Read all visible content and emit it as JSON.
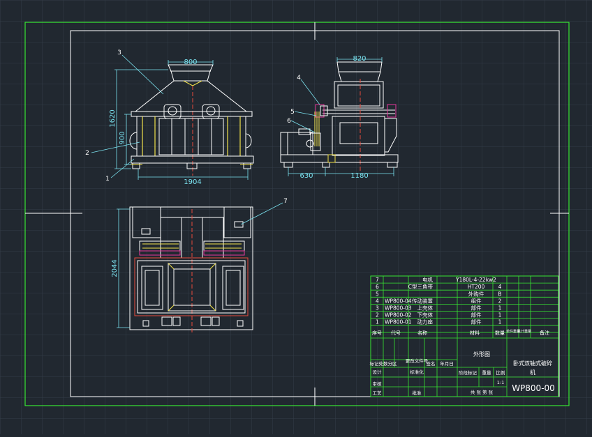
{
  "drawing": {
    "dimensions": {
      "top_width": "800",
      "height_total": "1620",
      "height_body": "900",
      "base_width": "1904",
      "side_width": "820",
      "motor_offset": "630",
      "side_base": "1180",
      "plan_depth": "2044"
    },
    "balloons": [
      "1",
      "2",
      "3",
      "4",
      "5",
      "6",
      "7"
    ]
  },
  "title_block": {
    "parts": [
      {
        "no": "7",
        "code": "",
        "name": "电机",
        "material": "Y180L-4-22kw2",
        "qty": "",
        "note": ""
      },
      {
        "no": "6",
        "code": "",
        "name": "C型三角带",
        "material": "HT200",
        "qty": "4",
        "note": ""
      },
      {
        "no": "5",
        "code": "",
        "name": "",
        "material": "外购件",
        "qty": "B",
        "note": ""
      },
      {
        "no": "4",
        "code": "WP800-04",
        "name": "传动装置",
        "material": "组件",
        "qty": "2",
        "note": ""
      },
      {
        "no": "3",
        "code": "WP800-03",
        "name": "上壳体",
        "material": "部件",
        "qty": "1",
        "note": ""
      },
      {
        "no": "2",
        "code": "WP800-02",
        "name": "下壳体",
        "material": "部件",
        "qty": "1",
        "note": ""
      },
      {
        "no": "1",
        "code": "WP800-01",
        "name": "动力座",
        "material": "部件",
        "qty": "1",
        "note": ""
      }
    ],
    "headers": {
      "seq": "序号",
      "code": "代号",
      "name": "名称",
      "material": "材料",
      "qty": "数量",
      "unit_weight": "单件重量",
      "total_weight": "总计重量",
      "note": "备注"
    },
    "drawing_title": "外形图",
    "product_name_line1": "卧式双轴式破碎",
    "product_name_line2": "机",
    "drawing_number": "WP800-00",
    "labels": {
      "mark": "标记",
      "count": "处数",
      "zone": "分区",
      "change_doc": "更改文件号",
      "signature": "签名",
      "date": "年月日",
      "design": "设计",
      "standardize": "标准化",
      "stage_mark": "阶段标记",
      "weight": "重量",
      "scale": "比例",
      "review": "审核",
      "process": "工艺",
      "approve": "批准",
      "sheets": "共 张 第 张"
    },
    "scale_value": "1:1"
  },
  "colors": {
    "background": "#212830",
    "frame": "#37e632",
    "outline": "#ffffff",
    "dimension": "#7be3f0",
    "hidden": "#f2e24a",
    "motor": "#e6399b",
    "center": "#e84a3c",
    "grid": "#343d47"
  }
}
